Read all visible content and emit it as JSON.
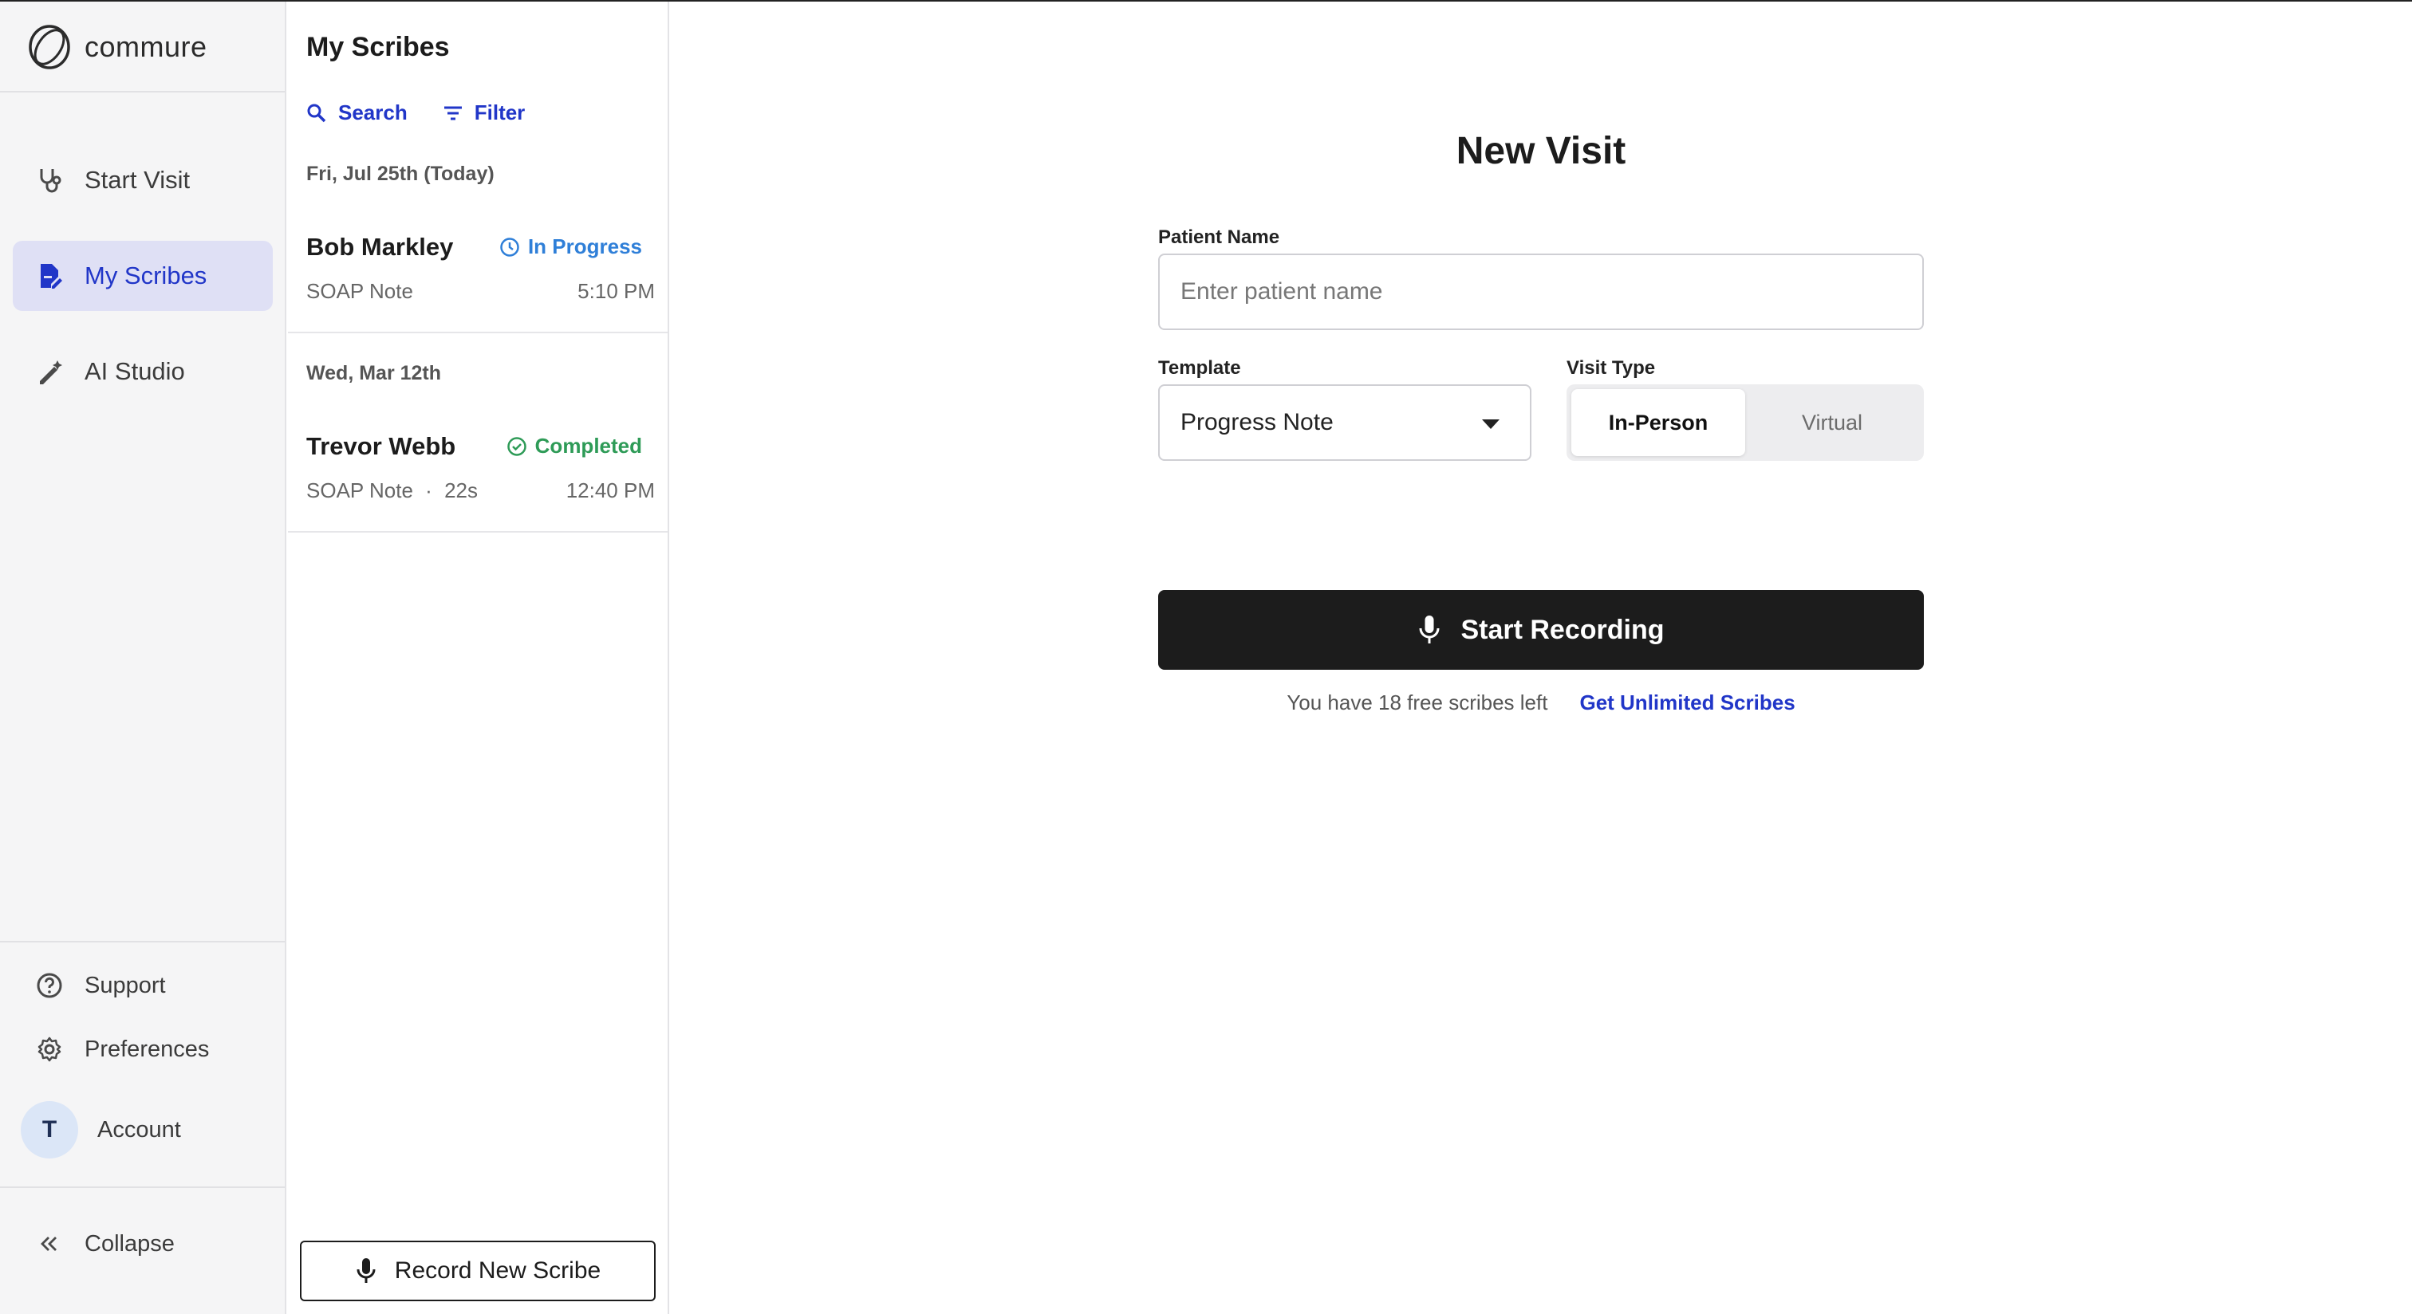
{
  "app": {
    "brand": "commure"
  },
  "nav": {
    "items": [
      {
        "label": "Start Visit",
        "icon": "stethoscope-icon",
        "active": false
      },
      {
        "label": "My Scribes",
        "icon": "document-edit-icon",
        "active": true
      },
      {
        "label": "AI Studio",
        "icon": "magic-pen-icon",
        "active": false
      }
    ],
    "bottom": {
      "support": "Support",
      "preferences": "Preferences",
      "account": "Account",
      "avatar_initial": "T",
      "collapse": "Collapse"
    }
  },
  "scribes": {
    "title": "My Scribes",
    "search_label": "Search",
    "filter_label": "Filter",
    "groups": [
      {
        "date": "Fri, Jul 25th (Today)",
        "items": [
          {
            "name": "Bob Markley",
            "status": "In Progress",
            "note": "SOAP Note",
            "time": "5:10 PM"
          }
        ]
      },
      {
        "date": "Wed, Mar 12th",
        "items": [
          {
            "name": "Trevor Webb",
            "status": "Completed",
            "note": "SOAP Note",
            "duration": "22s",
            "separator": "·",
            "time": "12:40 PM"
          }
        ]
      }
    ],
    "record_button": "Record New Scribe"
  },
  "visit": {
    "title": "New Visit",
    "patient_label": "Patient Name",
    "patient_placeholder": "Enter patient name",
    "patient_value": "",
    "template_label": "Template",
    "template_value": "Progress Note",
    "visit_type_label": "Visit Type",
    "visit_type_options": [
      "In-Person",
      "Virtual"
    ],
    "visit_type_selected": "In-Person",
    "start_button": "Start Recording",
    "free_text": "You have 18 free scribes left",
    "upgrade_link": "Get Unlimited Scribes"
  },
  "colors": {
    "accent": "#2136c8",
    "in_progress": "#2f7fd8",
    "completed": "#2e9b57",
    "nav_active_bg": "#dfe0f5",
    "primary_button": "#1c1c1c"
  }
}
